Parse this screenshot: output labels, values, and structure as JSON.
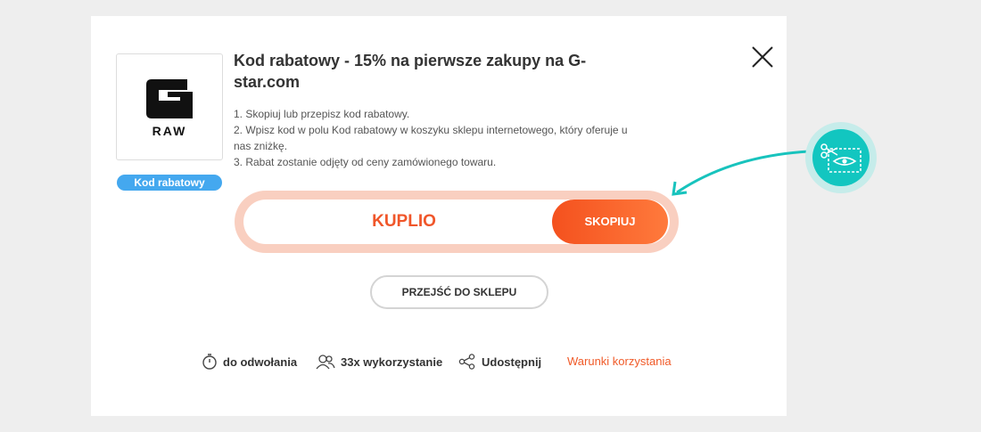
{
  "logo": {
    "text": "RAW",
    "icon": "g-star-raw-logo"
  },
  "badge": "Kod rabatowy",
  "title": "Kod rabatowy - 15% na pierwsze zakupy na G-star.com",
  "steps": [
    "1. Skopiuj lub przepisz kod rabatowy.",
    "2. Wpisz kod w polu Kod rabatowy w koszyku sklepu internetowego, który oferuje u nas zniżkę.",
    "3. Rabat zostanie odjęty od ceny zamówionego towaru."
  ],
  "code": {
    "value": "KUPLIO",
    "copy_label": "SKOPIUJ"
  },
  "shop_button": "PRZEJŚĆ DO SKLEPU",
  "meta": {
    "validity": "do odwołania",
    "usage": "33x wykorzystanie",
    "share": "Udostępnij",
    "terms": "Warunki korzystania"
  },
  "colors": {
    "accent": "#f05a28",
    "badge": "#44a8ef",
    "hint": "#12c6c0"
  }
}
